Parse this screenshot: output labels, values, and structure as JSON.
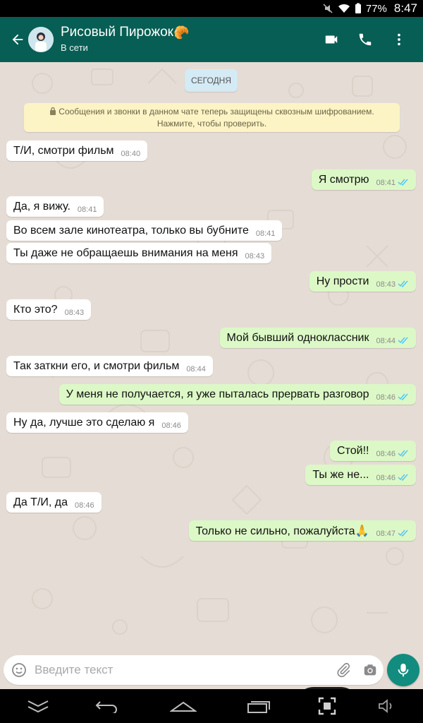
{
  "status_bar": {
    "battery": "77%",
    "time": "8:47"
  },
  "header": {
    "contact_name": "Рисовый Пирожок",
    "contact_emoji": "🥐",
    "status": "В сети",
    "icons": {
      "back": "arrow-left-icon",
      "video": "video-call-icon",
      "call": "phone-icon",
      "menu": "more-vertical-icon"
    },
    "bg_color": "#075e54"
  },
  "chat": {
    "date_chip": "СЕГОДНЯ",
    "encryption_notice": {
      "line1": "Сообщения и звонки в данном чате теперь защищены сквозным шифрованием.",
      "line2": "Нажмите, чтобы проверить."
    },
    "messages": [
      {
        "dir": "in",
        "text": "Т/И, смотри фильм",
        "time": "08:40"
      },
      {
        "dir": "out",
        "text": "Я смотрю",
        "time": "08:41",
        "read": true
      },
      {
        "dir": "in",
        "text": "Да, я вижу.",
        "time": "08:41"
      },
      {
        "dir": "in",
        "text": "Во всем зале кинотеатра, только вы бубните",
        "time": "08:41"
      },
      {
        "dir": "in",
        "text": "Ты даже не обращаешь внимания на меня",
        "time": "08:43"
      },
      {
        "dir": "out",
        "text": "Ну прости",
        "time": "08:43",
        "read": true
      },
      {
        "dir": "in",
        "text": "Кто это?",
        "time": "08:43"
      },
      {
        "dir": "out",
        "text": "Мой бывший одноклассник",
        "time": "08:44",
        "read": true
      },
      {
        "dir": "in",
        "text": "Так заткни его, и смотри фильм",
        "time": "08:44"
      },
      {
        "dir": "out",
        "text": "У меня не получается, я уже пыталась прервать разговор",
        "time": "08:46",
        "read": true
      },
      {
        "dir": "in",
        "text": "Ну да, лучше это сделаю я",
        "time": "08:46"
      },
      {
        "dir": "out",
        "text": "Стой!!",
        "time": "08:46",
        "read": true
      },
      {
        "dir": "out",
        "text": "Ты же не...",
        "time": "08:46",
        "read": true
      },
      {
        "dir": "in",
        "text": "Да Т/И, да",
        "time": "08:46"
      },
      {
        "dir": "out",
        "text": "Только не сильно, пожалуйста🙏",
        "time": "08:47",
        "read": true
      }
    ],
    "colors": {
      "incoming": "#ffffff",
      "outgoing": "#dcf8c6",
      "read_ticks": "#4fc3f7",
      "background": "#e5ddd5"
    }
  },
  "composer": {
    "placeholder": "Введите текст",
    "icons": {
      "emoji": "smiley-icon",
      "attach": "paperclip-icon",
      "camera": "camera-icon",
      "mic": "microphone-icon"
    },
    "accent": "#128c7e"
  },
  "nav_bar": {
    "icons": [
      "collapse-icon",
      "back-icon",
      "home-icon",
      "recents-icon",
      "screenshot-icon",
      "volume-icon"
    ]
  }
}
